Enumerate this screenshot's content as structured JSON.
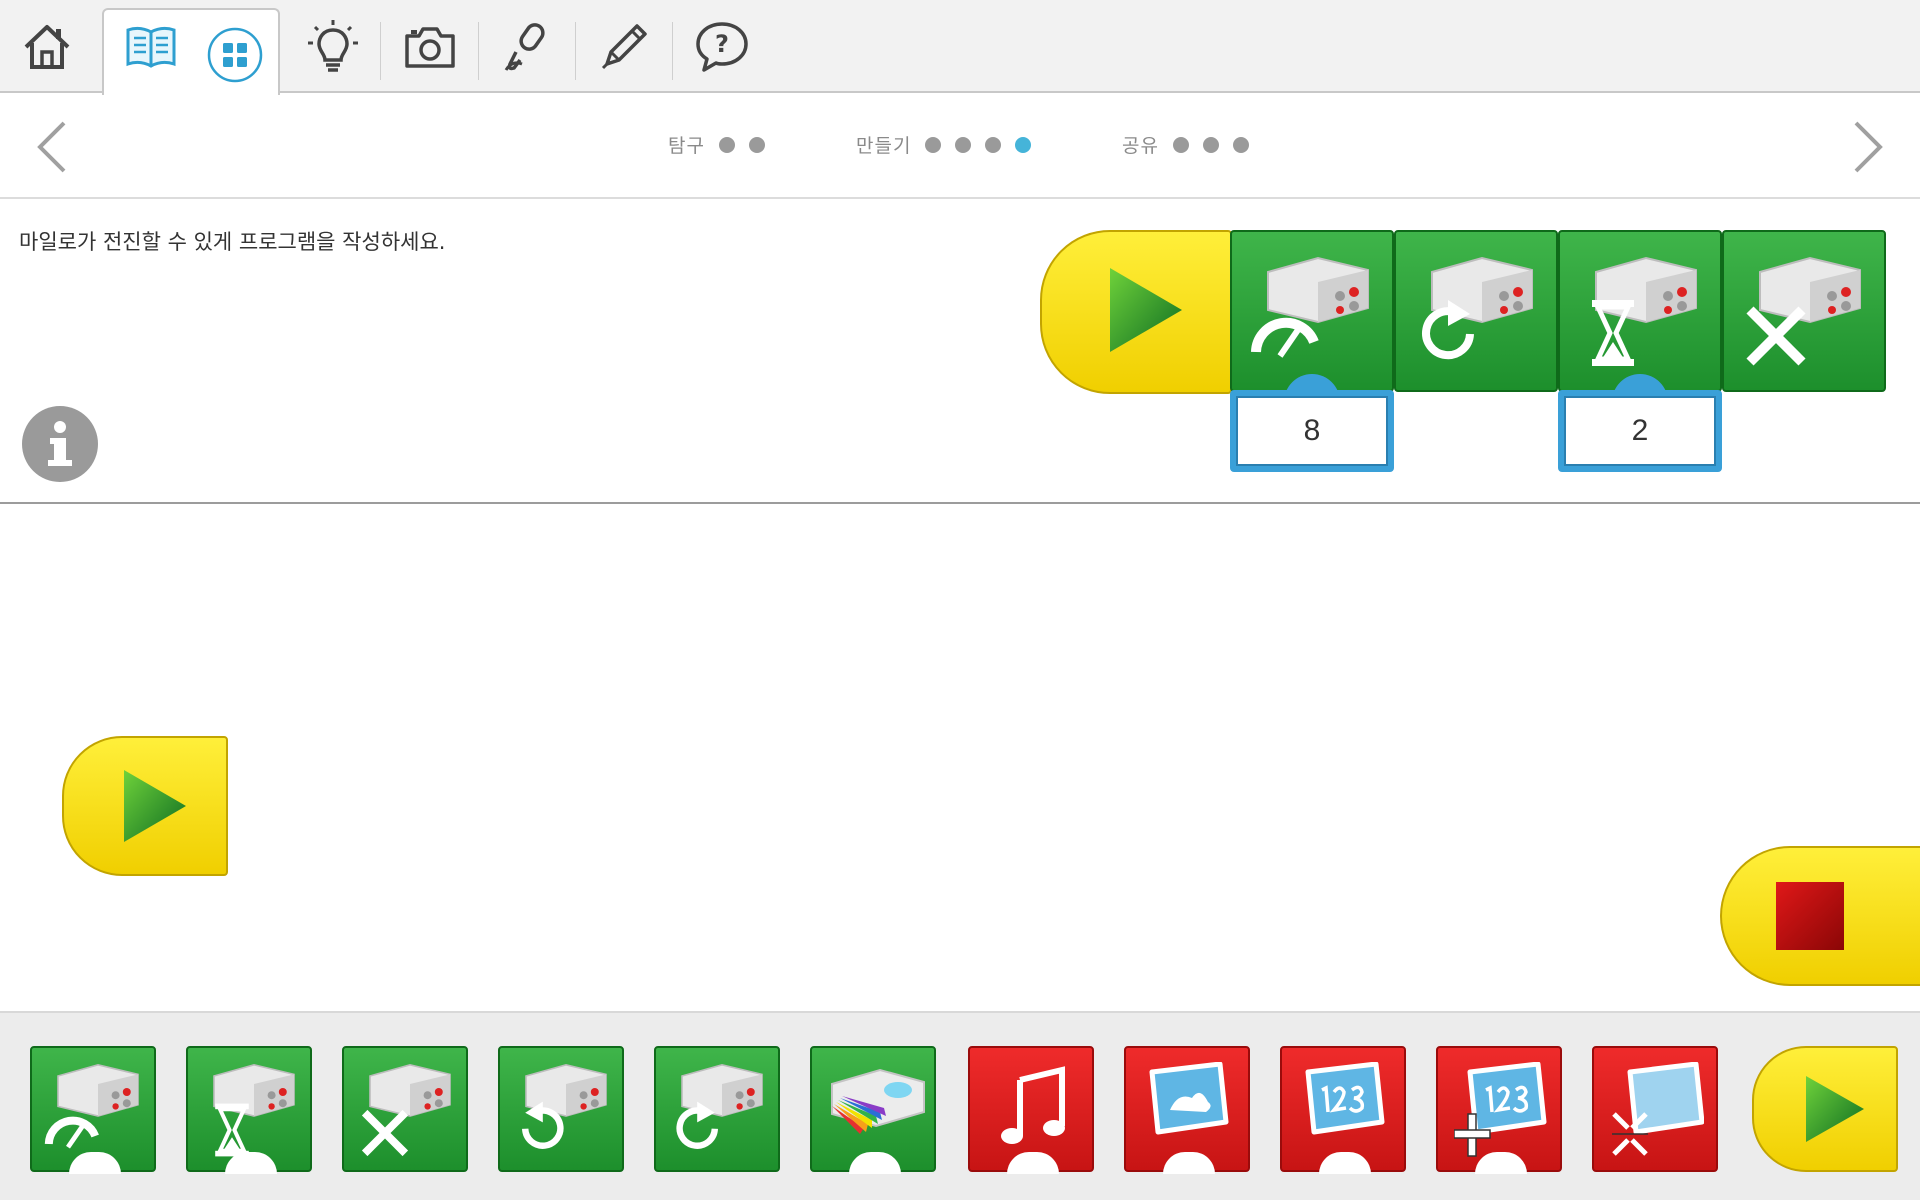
{
  "toolbar": {
    "items": [
      {
        "icon": "home-icon"
      },
      {
        "icon": "book-icon"
      },
      {
        "icon": "grid-icon"
      },
      {
        "icon": "lightbulb-icon"
      },
      {
        "icon": "camera-icon"
      },
      {
        "icon": "microphone-icon"
      },
      {
        "icon": "pencil-icon"
      },
      {
        "icon": "help-icon"
      }
    ]
  },
  "stepper": {
    "stages": [
      {
        "label": "탐구",
        "dots": 2,
        "active_dot": -1
      },
      {
        "label": "만들기",
        "dots": 4,
        "active_dot": 3
      },
      {
        "label": "공유",
        "dots": 3,
        "active_dot": -1
      }
    ]
  },
  "instruction": {
    "text": "마일로가 전진할 수 있게 프로그램을 작성하세요."
  },
  "example_program": {
    "blocks": [
      "start-block",
      "motor-power-block",
      "motor-direction-block",
      "motor-on-for-block",
      "motor-off-block"
    ],
    "power_value": "8",
    "time_value": "2"
  },
  "palette": {
    "blocks": [
      "motor-power-block",
      "motor-on-for-block",
      "motor-off-block",
      "motor-counterclockwise-block",
      "motor-clockwise-block",
      "light-color-block",
      "play-sound-block",
      "display-background-block",
      "display-number-block",
      "add-to-display-block",
      "shrink-display-block",
      "start-block"
    ]
  },
  "colors": {
    "accent": "#45b4d9",
    "green_block": "#22962f",
    "red_block": "#d91a1a",
    "yellow_block": "#f7e000",
    "param_blue": "#3aa0d8"
  }
}
